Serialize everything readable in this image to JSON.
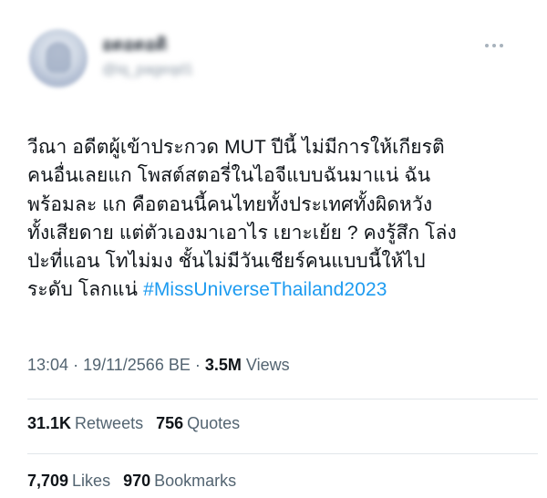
{
  "author": {
    "display_name": "อดอดอดิ",
    "handle": "@iq_pageqd1"
  },
  "tweet": {
    "lines": [
      "วีณา อดีตผู้เข้าประกวด MUT ปีนี้ ไม่มีการให้เกียรติ",
      "คนอื่นเลยแก โพสต์สตอรี่ในไอจีแบบฉันมาแน่ ฉัน",
      "พร้อมละ แก คือตอนนี้คนไทยทั้งประเทศทั้งผิดหวัง",
      "ทั้งเสียดาย แต่ตัวเองมาเอาไร เยาะเย้ย ? คงรู้สึก โล่ง",
      "ป่ะที่แอน โทไม่มง ชั้นไม่มีวันเชียร์คนแบบนี้ให้ไป",
      "ระดับ โลกแน่ "
    ],
    "hashtag": "#MissUniverseThailand2023",
    "time": "13:04",
    "separator": "·",
    "date": "19/11/2566 BE",
    "views_count": "3.5M",
    "views_label": "Views"
  },
  "stats": {
    "retweets_count": "31.1K",
    "retweets_label": "Retweets",
    "quotes_count": "756",
    "quotes_label": "Quotes",
    "likes_count": "7,709",
    "likes_label": "Likes",
    "bookmarks_count": "970",
    "bookmarks_label": "Bookmarks"
  },
  "colors": {
    "hashtag": "#1d9bf0",
    "text": "#0f1419",
    "secondary": "#536471",
    "divider": "#e1e6ea"
  },
  "icons": {
    "more": "more-dots-icon"
  }
}
